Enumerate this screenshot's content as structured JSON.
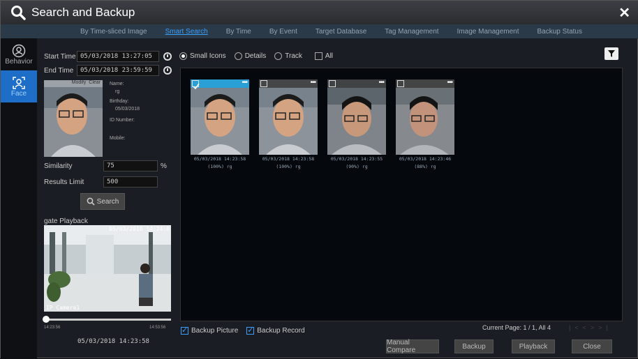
{
  "window": {
    "title": "Search and Backup"
  },
  "tabs": [
    {
      "label": "By Time-sliced Image"
    },
    {
      "label": "Smart Search"
    },
    {
      "label": "By Time"
    },
    {
      "label": "By Event"
    },
    {
      "label": "Target Database"
    },
    {
      "label": "Tag Management"
    },
    {
      "label": "Image Management"
    },
    {
      "label": "Backup Status"
    }
  ],
  "sidebar": {
    "items": [
      {
        "label": "Behavior"
      },
      {
        "label": "Face"
      }
    ]
  },
  "left": {
    "start_label": "Start Time",
    "start_value": "05/03/2018 13:27:05",
    "end_label": "End Time",
    "end_value": "05/03/2018 23:59:59",
    "face_modify": "Modify",
    "face_clear": "Clear",
    "name_label": "Name:",
    "name_value": "rg",
    "birthday_label": "Birthday:",
    "birthday_value": "05/03/2018",
    "id_label": "ID Number:",
    "mobile_label": "Mobile:",
    "similarity_label": "Similarity",
    "similarity_value": "75",
    "similarity_unit": "%",
    "limit_label": "Results Limit",
    "limit_value": "500",
    "search_label": "Search",
    "playback_label": "gate Playback",
    "video_timestamp": "05/03/2018 14:24:0",
    "video_camera": "IP Camera1",
    "slider_start": "14:23:56",
    "slider_end": "14:53:56",
    "current_time": "05/03/2018 14:23:58"
  },
  "main": {
    "view_small": "Small Icons",
    "view_details": "Details",
    "view_track": "Track",
    "all_label": "All",
    "results": [
      {
        "time": "05/03/2018 14:23:58",
        "score": "(100%) rg"
      },
      {
        "time": "05/03/2018 14:23:58",
        "score": "(100%) rg"
      },
      {
        "time": "05/03/2018 14:23:55",
        "score": "(90%) rg"
      },
      {
        "time": "05/03/2018 14:23:46",
        "score": "(88%) rg"
      }
    ],
    "backup_picture": "Backup Picture",
    "backup_record": "Backup Record",
    "page_info": "Current Page: 1 / 1, All 4",
    "btn_manual": "Manual Compare",
    "btn_backup": "Backup",
    "btn_playback": "Playback",
    "btn_close": "Close"
  },
  "colors": {
    "accent": "#3aa0ff",
    "selected": "#2a9fd6"
  }
}
